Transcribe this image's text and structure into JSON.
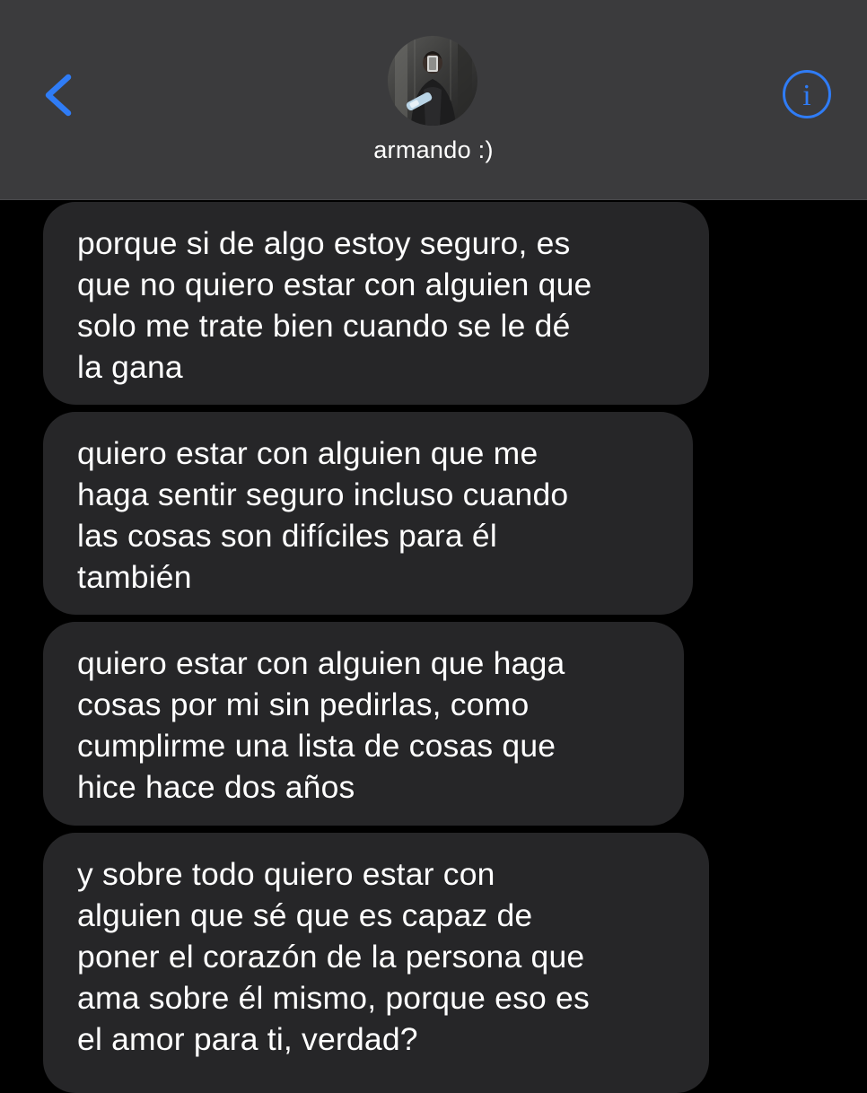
{
  "header": {
    "contact_name": "armando :)",
    "back_icon": "chevron-left-icon",
    "info_icon": "info-circle-icon",
    "accent_color": "#2f7cf6"
  },
  "messages": [
    {
      "direction": "received",
      "text": "porque si de algo estoy seguro, es\nque no quiero estar con alguien que\nsolo me trate bien cuando se le dé\nla gana"
    },
    {
      "direction": "received",
      "text": "quiero estar con alguien que me\nhaga sentir seguro incluso cuando\nlas cosas son difíciles para él\ntambién"
    },
    {
      "direction": "received",
      "text": "quiero estar con alguien que haga\ncosas por mi sin pedirlas, como\ncumplirme una lista de cosas que\nhice hace dos años"
    },
    {
      "direction": "received",
      "text": "y sobre todo quiero estar con\nalguien que sé que es capaz de\nponer el corazón de la persona que\nama sobre él mismo, porque eso es\nel amor para ti, verdad?"
    }
  ]
}
